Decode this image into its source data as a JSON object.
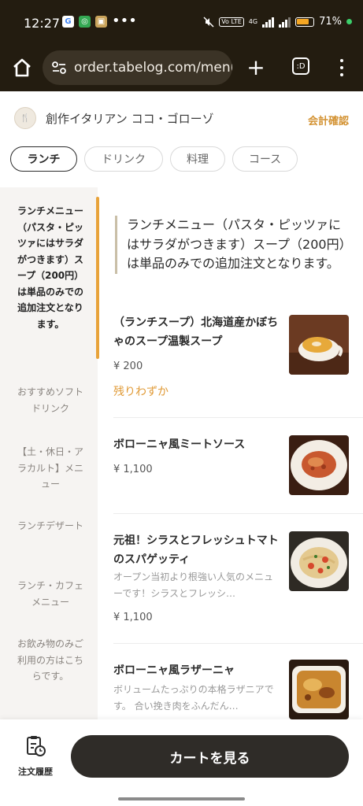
{
  "status_bar": {
    "time": "12:27",
    "battery": "71%",
    "app_icons": [
      {
        "icon": "google-g-icon",
        "color": "#4285f4",
        "glyph": "G"
      },
      {
        "icon": "google-photos-icon",
        "color": "#34a853",
        "glyph": "◎"
      },
      {
        "icon": "grocery-app-icon",
        "color": "#c9a35b",
        "glyph": "▣"
      }
    ],
    "more": "•••",
    "network_badge": "Vo LTE",
    "network_type": "4G"
  },
  "browser": {
    "url": "order.tabelog.com/menu",
    "tab_glyph": ":D"
  },
  "restaurant": {
    "name": "創作イタリアン ココ・ゴローゾ",
    "logo_glyph": "🍴",
    "checkout_label": "会計確認"
  },
  "tabs": [
    {
      "label": "ランチ",
      "active": true
    },
    {
      "label": "ドリンク",
      "active": false
    },
    {
      "label": "料理",
      "active": false
    },
    {
      "label": "コース",
      "active": false
    }
  ],
  "sidebar": {
    "items": [
      {
        "label": "ランチメニュー（パスタ・ピッツァにはサラダがつきます）スープ（200円）は単品のみでの追加注文となります。",
        "active": true
      },
      {
        "label": "おすすめソフトドリンク",
        "active": false
      },
      {
        "label": "【土・休日・アラカルト】メニュー",
        "active": false
      },
      {
        "label": "ランチデザート",
        "active": false
      },
      {
        "label": "ランチ・カフェメニュー",
        "active": false
      },
      {
        "label": "お飲み物のみご利用の方はこちらです。",
        "active": false
      }
    ]
  },
  "main": {
    "section_title": "ランチメニュー（パスタ・ピッツァにはサラダがつきます）スープ（200円）は単品のみでの追加注文となります。",
    "items": [
      {
        "name": "（ランチスープ）北海道産かぼちゃのスープ温製スープ",
        "description": "",
        "price": "¥ 200",
        "note": "残りわずか",
        "image": "pumpkin-soup"
      },
      {
        "name": "ボローニャ風ミートソース",
        "description": "",
        "price": "¥ 1,100",
        "note": "",
        "image": "meat-sauce-pasta"
      },
      {
        "name": "元祖！シラスとフレッシュトマトのスパゲッティ",
        "description": "オープン当初より根強い人気のメニューです！シラスとフレッシ…",
        "price": "¥ 1,100",
        "note": "",
        "image": "shirasu-tomato-spaghetti"
      },
      {
        "name": "ボローニャ風ラザーニャ",
        "description": "ボリュームたっぷりの本格ラザニアです。 合い挽き肉をふんだん…",
        "price": "",
        "note": "",
        "image": "lasagna"
      }
    ]
  },
  "bottom": {
    "history_label": "注文履歴",
    "cart_label": "カートを見る"
  },
  "colors": {
    "browser_dark": "#231c10",
    "accent_orange": "#e09a36",
    "cart_button": "#2f2c28",
    "sidebar_bg": "#f6f4f2"
  }
}
